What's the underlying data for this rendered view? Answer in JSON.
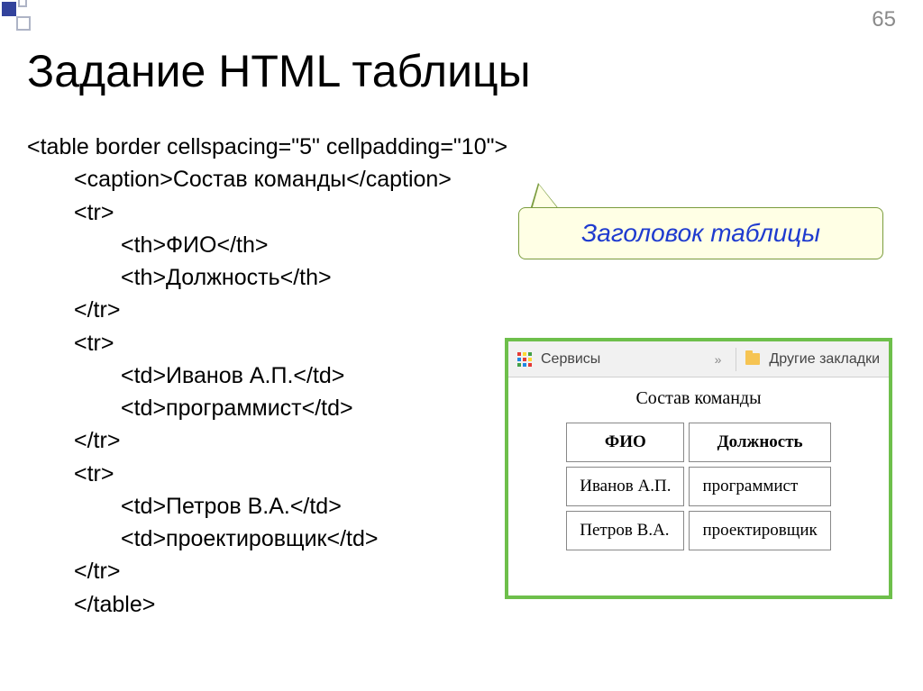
{
  "page_number": "65",
  "title": "Задание HTML таблицы",
  "code": {
    "l1": "<table border cellspacing=\"5\" cellpadding=\"10\">",
    "l2": "<caption>Состав команды</caption>",
    "l3": "<tr>",
    "l4": "<th>ФИО</th>",
    "l5": "<th>Должность</th>",
    "l6": "</tr>",
    "l7": "<tr>",
    "l8": "<td>Иванов А.П.</td>",
    "l9": "<td>программист</td>",
    "l10": "</tr>",
    "l11": "<tr>",
    "l12": "<td>Петров В.А.</td>",
    "l13": "<td>проектировщик</td>",
    "l14": "</tr>",
    "l15": "</table>"
  },
  "callout_text": "Заголовок таблицы",
  "toolbar": {
    "services": "Сервисы",
    "chevrons": "»",
    "other_bookmarks": "Другие закладки"
  },
  "preview": {
    "caption": "Состав команды",
    "headers": {
      "fio": "ФИО",
      "role": "Должность"
    },
    "rows": [
      {
        "fio": "Иванов А.П.",
        "role": "программист"
      },
      {
        "fio": "Петров В.А.",
        "role": "проектировщик"
      }
    ]
  }
}
